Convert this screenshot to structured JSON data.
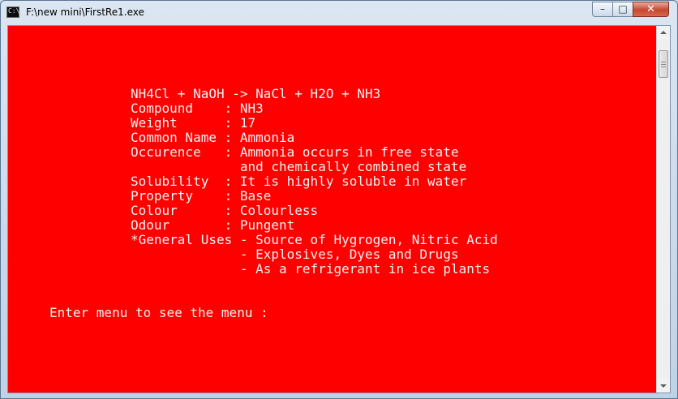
{
  "window": {
    "title": "F:\\new mini\\FirstRe1.exe",
    "console_bg": "#ff0000",
    "console_fg": "#f2f2f2"
  },
  "controls": {
    "minimize": "–",
    "maximize": "□",
    "close": "✕"
  },
  "console": {
    "lines": [
      "NH4Cl + NaOH -> NaCl + H2O + NH3",
      "Compound    : NH3",
      "Weight      : 17",
      "Common Name : Ammonia",
      "Occurence   : Ammonia occurs in free state",
      "              and chemically combined state",
      "Solubility  : It is highly soluble in water",
      "Property    : Base",
      "Colour      : Colourless",
      "Odour       : Pungent",
      "*General Uses - Source of Hygrogen, Nitric Acid",
      "              - Explosives, Dyes and Drugs",
      "              - As a refrigerant in ice plants"
    ],
    "prompt": "Enter menu to see the menu :"
  }
}
